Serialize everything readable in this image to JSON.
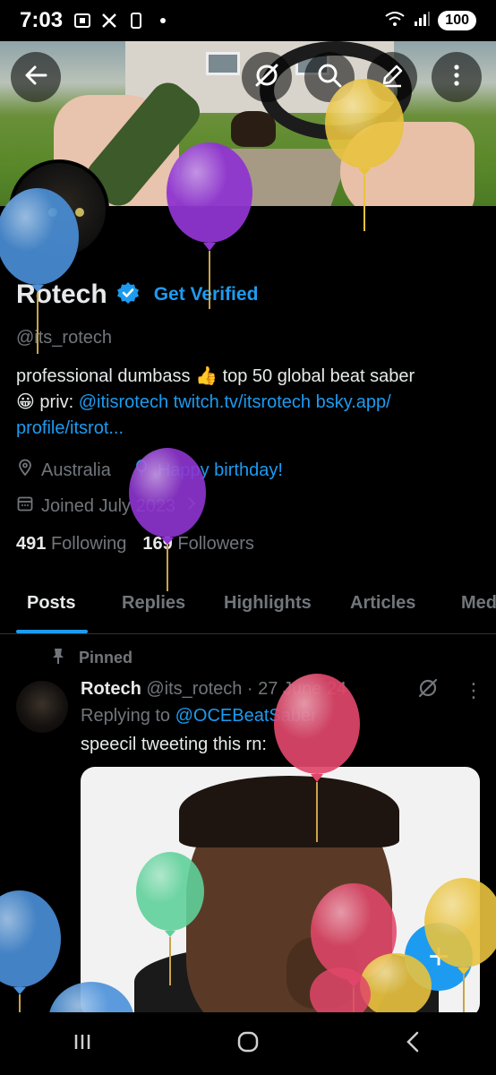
{
  "status_bar": {
    "time": "7:03",
    "battery": "100"
  },
  "header": {
    "back_icon": "arrow-left-icon",
    "grok_icon": "grok-icon",
    "search_icon": "search-icon",
    "edit_icon": "edit-pencil-icon",
    "more_icon": "more-vertical-icon"
  },
  "profile": {
    "name": "Rotech",
    "get_verified": "Get Verified",
    "handle": "@its_rotech",
    "bio_text": "professional dumbass 👍 top 50 global beat saber",
    "bio_line2_prefix": "😀  priv: ",
    "bio_link1": "@itisrotech",
    "bio_link2": "twitch.tv/itsrotech",
    "bio_link3": "bsky.app/",
    "bio_link4": "profile/itsrot...",
    "location": "Australia",
    "birthday": "Happy birthday!",
    "joined": "Joined July 2023",
    "following_count": "491",
    "following_label": "Following",
    "followers_count": "169",
    "followers_label": "Followers"
  },
  "tabs": [
    "Posts",
    "Replies",
    "Highlights",
    "Articles",
    "Media"
  ],
  "active_tab": "Posts",
  "tweet": {
    "pinned_label": "Pinned",
    "author": "Rotech",
    "handle_date": "@its_rotech · 27 June 24",
    "replying_prefix": "Replying to ",
    "replying_to": "@OCEBeatSaber",
    "text": "speecil tweeting this rn:"
  },
  "fab_label": "+",
  "colors": {
    "accent": "#1d9bf0",
    "background": "#000000",
    "text_primary": "#e7e9ea",
    "text_secondary": "#71767b"
  }
}
